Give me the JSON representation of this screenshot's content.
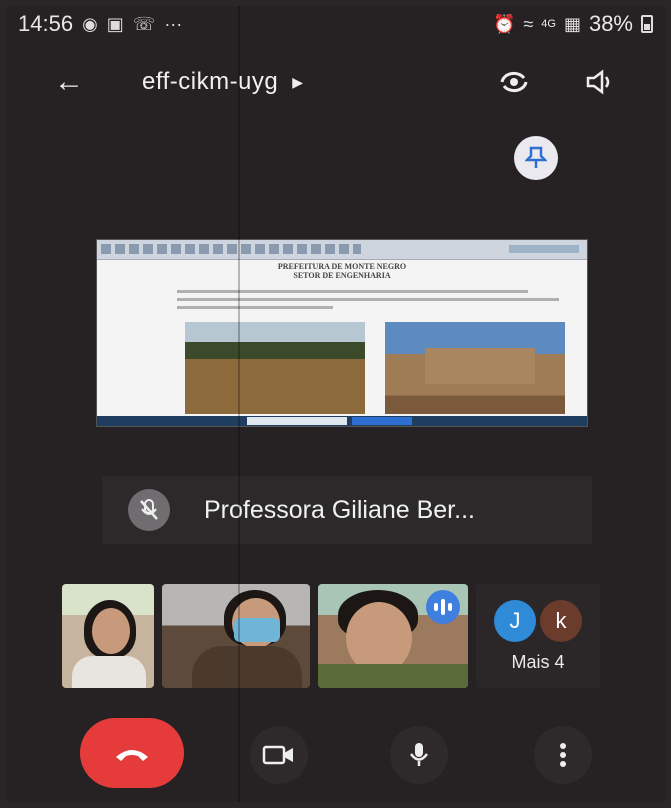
{
  "status_bar": {
    "time": "14:56",
    "network": "4G",
    "battery": "38%"
  },
  "header": {
    "meeting_code": "eff-cikm-uyg"
  },
  "shared_screen": {
    "doc_title_line1": "PREFEITURA DE MONTE NEGRO",
    "doc_title_line2": "SETOR DE ENGENHARIA"
  },
  "presenter": {
    "name": "Professora Giliane Ber..."
  },
  "participants": {
    "more_avatars": [
      "J",
      "k"
    ],
    "more_label": "Mais 4",
    "colors": {
      "avatar_j": "#2f8ad8",
      "avatar_k": "#6b3b2c",
      "speaking": "#3f7fe0"
    }
  },
  "controls": {
    "end_call_color": "#e53b3b"
  }
}
